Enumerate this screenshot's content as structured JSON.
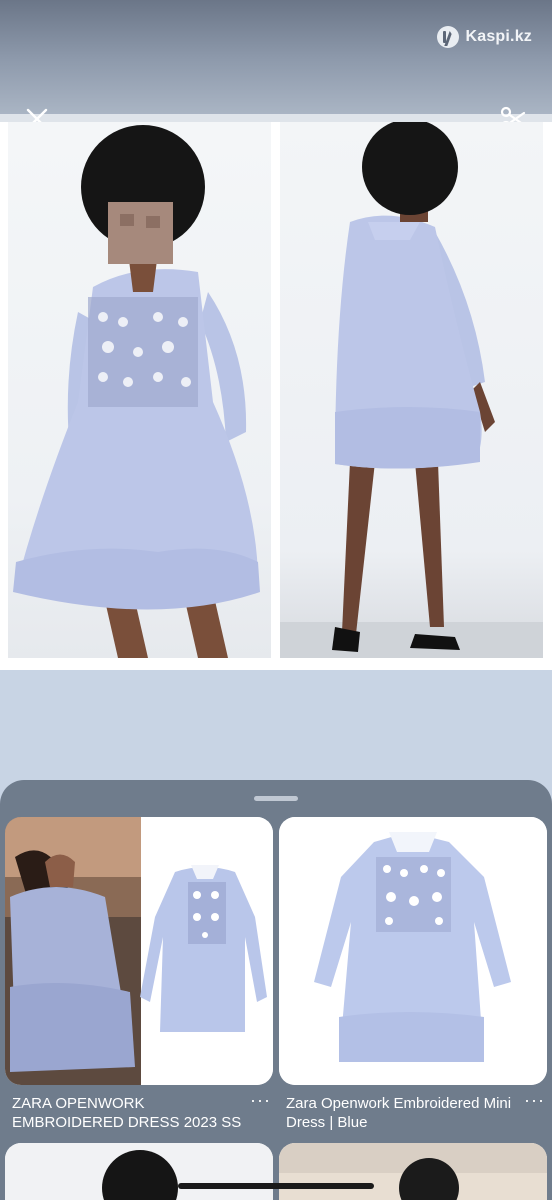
{
  "header": {
    "brand": "Kaspi.kz",
    "brand_icon": "kaspi-logo-icon"
  },
  "toolbar": {
    "close_icon": "close-icon",
    "crop_icon": "scissors-icon"
  },
  "image": {
    "panels": [
      "dress-front-view",
      "dress-back-view"
    ]
  },
  "results": [
    {
      "title": "ZARA OPENWORK EMBROIDERED DRESS 2023 SS",
      "more": "···"
    },
    {
      "title": "Zara Openwork Embroidered Mini Dress | Blue",
      "more": "···"
    },
    {
      "title": "",
      "more": ""
    },
    {
      "title": "",
      "more": ""
    }
  ],
  "colors": {
    "dress": "#b9c4e6",
    "sheet": "#6f7c8c",
    "background": "#c8d4e4"
  }
}
